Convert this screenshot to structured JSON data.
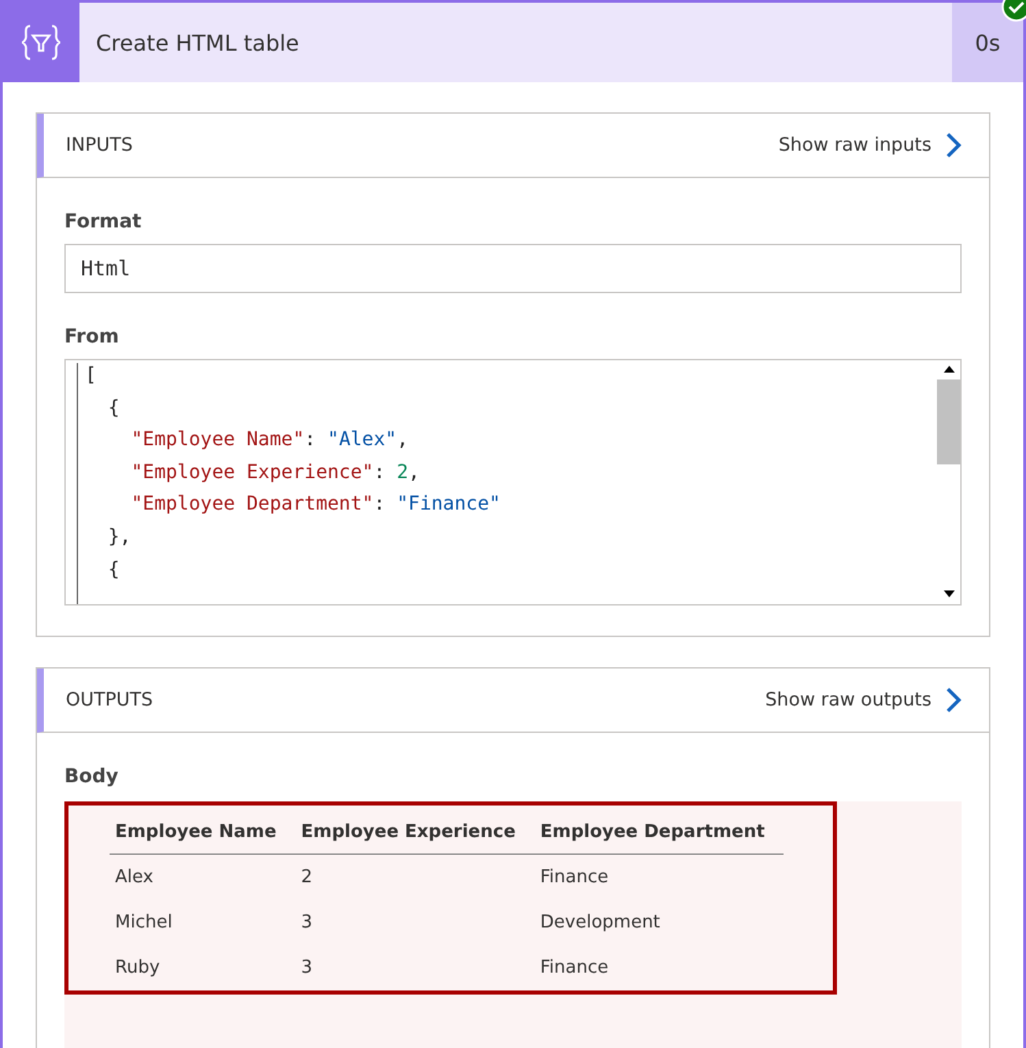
{
  "header": {
    "title": "Create HTML table",
    "duration": "0s",
    "succeeded": true
  },
  "inputs": {
    "title": "INPUTS",
    "link": "Show raw inputs",
    "format": {
      "label": "Format",
      "value": "Html"
    },
    "from": {
      "label": "From",
      "lines": [
        {
          "tokens": [
            {
              "kind": "punct",
              "text": "["
            }
          ],
          "children": [
            {
              "tokens": [
                {
                  "kind": "punct",
                  "text": "{"
                }
              ],
              "children": [
                {
                  "tokens": [
                    {
                      "kind": "key",
                      "text": "\"Employee Name\""
                    },
                    {
                      "kind": "punct",
                      "text": ": "
                    },
                    {
                      "kind": "string",
                      "text": "\"Alex\""
                    },
                    {
                      "kind": "punct",
                      "text": ","
                    }
                  ]
                },
                {
                  "tokens": [
                    {
                      "kind": "key",
                      "text": "\"Employee Experience\""
                    },
                    {
                      "kind": "punct",
                      "text": ": "
                    },
                    {
                      "kind": "number",
                      "text": "2"
                    },
                    {
                      "kind": "punct",
                      "text": ","
                    }
                  ]
                },
                {
                  "tokens": [
                    {
                      "kind": "key",
                      "text": "\"Employee Department\""
                    },
                    {
                      "kind": "punct",
                      "text": ": "
                    },
                    {
                      "kind": "string",
                      "text": "\"Finance\""
                    }
                  ]
                }
              ]
            },
            {
              "tokens": [
                {
                  "kind": "punct",
                  "text": "},"
                }
              ]
            },
            {
              "tokens": [
                {
                  "kind": "punct",
                  "text": "{"
                }
              ]
            }
          ]
        }
      ]
    }
  },
  "outputs": {
    "title": "OUTPUTS",
    "link": "Show raw outputs",
    "body": {
      "label": "Body",
      "highlighted": true,
      "columns": [
        "Employee Name",
        "Employee Experience",
        "Employee Department"
      ],
      "rows": [
        [
          "Alex",
          "2",
          "Finance"
        ],
        [
          "Michel",
          "3",
          "Development"
        ],
        [
          "Ruby",
          "3",
          "Finance"
        ]
      ]
    }
  }
}
